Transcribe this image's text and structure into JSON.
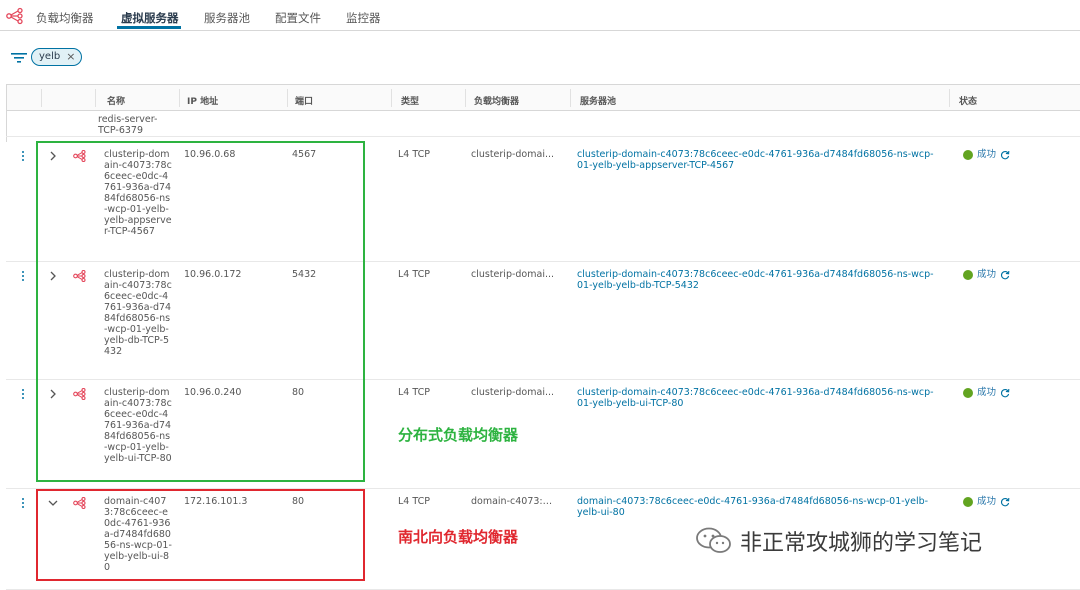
{
  "nav": {
    "tabs": [
      {
        "label": "负载均衡器",
        "active": false
      },
      {
        "label": "虚拟服务器",
        "active": true
      },
      {
        "label": "服务器池",
        "active": false
      },
      {
        "label": "配置文件",
        "active": false
      },
      {
        "label": "监控器",
        "active": false
      }
    ]
  },
  "filter": {
    "chip_label": "yelb",
    "remove_glyph": "×"
  },
  "table": {
    "headers": {
      "name": "名称",
      "ip": "IP 地址",
      "port": "端口",
      "type": "类型",
      "lb": "负载均衡器",
      "pool": "服务器池",
      "status": "状态"
    },
    "partial_row_name": "redis-server-\nTCP-6379",
    "rows": [
      {
        "name": "clusterip-domain-c4073:78c6ceec-e0dc-4761-936a-d7484fd68056-ns-wcp-01-yelb-yelb-appserver-TCP-4567",
        "ip": "10.96.0.68",
        "port": "4567",
        "type": "L4 TCP",
        "lb": "clusterip-domai...",
        "pool": "clusterip-domain-c4073:78c6ceec-e0dc-4761-936a-d7484fd68056-ns-wcp-01-yelb-yelb-appserver-TCP-4567",
        "status": "成功",
        "expanded": false
      },
      {
        "name": "clusterip-domain-c4073:78c6ceec-e0dc-4761-936a-d7484fd68056-ns-wcp-01-yelb-yelb-db-TCP-5432",
        "ip": "10.96.0.172",
        "port": "5432",
        "type": "L4 TCP",
        "lb": "clusterip-domai...",
        "pool": "clusterip-domain-c4073:78c6ceec-e0dc-4761-936a-d7484fd68056-ns-wcp-01-yelb-yelb-db-TCP-5432",
        "status": "成功",
        "expanded": false
      },
      {
        "name": "clusterip-domain-c4073:78c6ceec-e0dc-4761-936a-d7484fd68056-ns-wcp-01-yelb-yelb-ui-TCP-80",
        "ip": "10.96.0.240",
        "port": "80",
        "type": "L4 TCP",
        "lb": "clusterip-domai...",
        "pool": "clusterip-domain-c4073:78c6ceec-e0dc-4761-936a-d7484fd68056-ns-wcp-01-yelb-yelb-ui-TCP-80",
        "status": "成功",
        "expanded": false
      },
      {
        "name": "domain-c4073:78c6ceec-e0dc-4761-936a-d7484fd68056-ns-wcp-01-yelb-yelb-ui-80",
        "ip": "172.16.101.3",
        "port": "80",
        "type": "L4 TCP",
        "lb": "domain-c4073:7...",
        "pool": "domain-c4073:78c6ceec-e0dc-4761-936a-d7484fd68056-ns-wcp-01-yelb-yelb-ui-80",
        "status": "成功",
        "expanded": true
      }
    ]
  },
  "annotations": {
    "distributed_lb": "分布式负载均衡器",
    "north_south_lb": "南北向负载均衡器"
  },
  "watermark": {
    "text": "非正常攻城狮的学习笔记"
  },
  "colors": {
    "accent": "#0072a3",
    "success": "#62a420",
    "annotation_green": "#2db340",
    "annotation_red": "#e0272f",
    "vs_icon": "#e4475b"
  }
}
